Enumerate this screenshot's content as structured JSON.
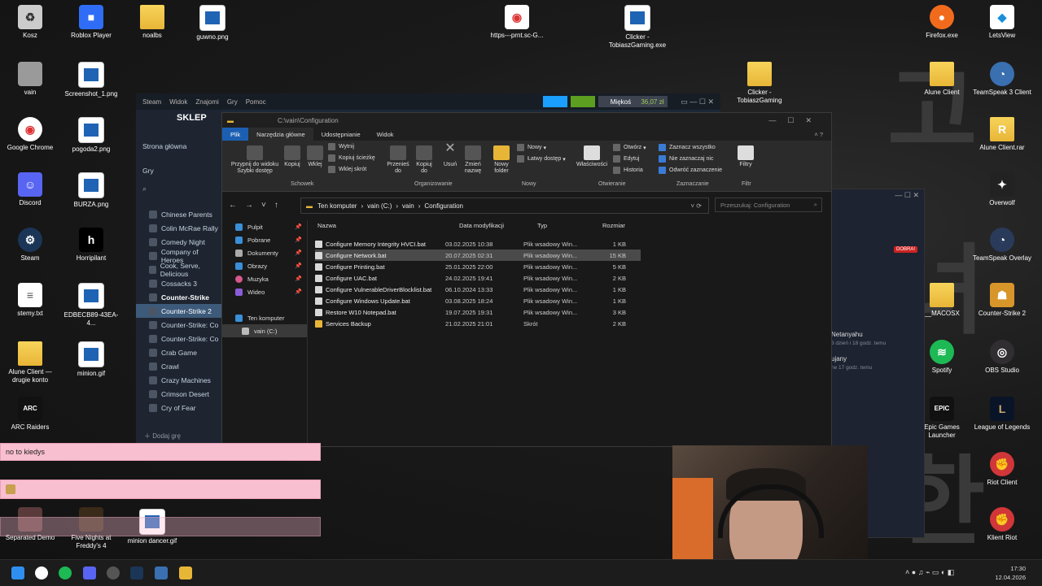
{
  "desktop_icons": [
    {
      "label": "Kosz",
      "icon": "recycle-bin-icon"
    },
    {
      "label": "Roblox Player",
      "icon": "roblox-icon"
    },
    {
      "label": "noalbs",
      "icon": "folder-icon"
    },
    {
      "label": "guwno.png",
      "icon": "image-icon"
    },
    {
      "label": "https---prnt.sc-G...",
      "icon": "chrome-icon"
    },
    {
      "label": "Clicker - TobiaszGaming.exe",
      "icon": "app-icon"
    },
    {
      "label": "Firefox.exe",
      "icon": "firefox-icon"
    },
    {
      "label": "LetsView",
      "icon": "letsview-icon"
    },
    {
      "label": "vain",
      "icon": "folder-icon"
    },
    {
      "label": "Screenshot_1.png",
      "icon": "image-icon"
    },
    {
      "label": "Clicker - TobiaszGaming",
      "icon": "folder-icon"
    },
    {
      "label": "Alune Client",
      "icon": "folder-icon"
    },
    {
      "label": "TeamSpeak 3 Client",
      "icon": "teamspeak-icon"
    },
    {
      "label": "Google Chrome",
      "icon": "chrome-icon"
    },
    {
      "label": "pogoda2.png",
      "icon": "image-icon"
    },
    {
      "label": "Alune Client.rar",
      "icon": "rar-icon"
    },
    {
      "label": "Discord",
      "icon": "discord-icon"
    },
    {
      "label": "BURZA.png",
      "icon": "image-icon"
    },
    {
      "label": "Overwolf",
      "icon": "overwolf-icon"
    },
    {
      "label": "Steam",
      "icon": "steam-icon"
    },
    {
      "label": "Horripilant",
      "icon": "horripilant-icon"
    },
    {
      "label": "TeamSpeak Overlay",
      "icon": "teamspeak-overlay-icon"
    },
    {
      "label": "stemy.txt",
      "icon": "text-file-icon"
    },
    {
      "label": "EDBECB89-43EA-4...",
      "icon": "image-icon"
    },
    {
      "label": "__MACOSX",
      "icon": "folder-icon"
    },
    {
      "label": "Counter-Strike 2",
      "icon": "cs2-icon"
    },
    {
      "label": "Alune Client — drugie konto",
      "icon": "folder-icon"
    },
    {
      "label": "minion.gif",
      "icon": "image-icon"
    },
    {
      "label": "Spotify",
      "icon": "spotify-icon"
    },
    {
      "label": "OBS Studio",
      "icon": "obs-icon"
    },
    {
      "label": "ARC Raiders",
      "icon": "arc-raiders-icon"
    },
    {
      "label": "Epic Games Launcher",
      "icon": "epic-icon"
    },
    {
      "label": "League of Legends",
      "icon": "lol-icon"
    },
    {
      "label": "Riot Client",
      "icon": "riot-icon"
    },
    {
      "label": "Separated Demo",
      "icon": "game-icon"
    },
    {
      "label": "Five Nights at Freddy's 4",
      "icon": "game-icon"
    },
    {
      "label": "minion dancer.gif",
      "icon": "image-icon"
    },
    {
      "label": "Klient Riot",
      "icon": "riot-icon"
    }
  ],
  "steam": {
    "menu": [
      "Steam",
      "Widok",
      "Znajomi",
      "Gry",
      "Pomoc"
    ],
    "store_label": "SKLEP",
    "store_home": "Strona główna",
    "games_label": "Gry",
    "user_name": "Miękoś",
    "wallet": "36,07 zł",
    "add_game": "Dodaj grę",
    "games": [
      "Chinese Parents",
      "Colin McRae Rally",
      "Comedy Night",
      "Company of Heroes",
      "Cook, Serve, Delicious",
      "Cossacks 3",
      "Counter-Strike",
      "Counter-Strike 2",
      "Counter-Strike: Co",
      "Counter-Strike: Co",
      "Crab Game",
      "Crawl",
      "Crazy Machines",
      "Crimson Desert",
      "Cry of Fear"
    ]
  },
  "explorer": {
    "title_path": "C:\\vain\\Configuration",
    "tabs": [
      "Plik",
      "Narzędzia główne",
      "Udostępnianie",
      "Widok"
    ],
    "ribbon": {
      "pin": "Przypnij do widoku Szybki dostęp",
      "copy": "Kopiuj",
      "paste": "Wklej",
      "cut": "Wytnij",
      "copy_path": "Kopiuj ścieżkę",
      "paste_shortcut": "Wklej skrót",
      "move_to": "Przenieś do",
      "copy_to": "Kopiuj do",
      "delete": "Usuń",
      "rename": "Zmień nazwę",
      "new_folder": "Nowy folder",
      "new": "Nowy",
      "easy_access": "Łatwy dostęp",
      "properties": "Właściwości",
      "open": "Otwórz",
      "edit": "Edytuj",
      "history": "Historia",
      "select_all": "Zaznacz wszystko",
      "select_none": "Nie zaznaczaj nic",
      "invert": "Odwróć zaznaczenie",
      "filters": "Filtry",
      "groups": [
        "Schowek",
        "Organizowanie",
        "Nowy",
        "Otwieranie",
        "Zaznaczanie",
        "Filtr"
      ]
    },
    "breadcrumb": [
      "Ten komputer",
      "vain (C:)",
      "vain",
      "Configuration"
    ],
    "search_placeholder": "Przeszukaj: Configuration",
    "nav": [
      "Pulpit",
      "Pobrane",
      "Dokumenty",
      "Obrazy",
      "Muzyka",
      "Wideo",
      "Ten komputer",
      "vain (C:)"
    ],
    "columns": [
      "Nazwa",
      "Data modyfikacji",
      "Typ",
      "Rozmiar"
    ],
    "files": [
      {
        "name": "Configure Memory Integrity HVCI.bat",
        "date": "03.02.2025 10:38",
        "type": "Plik wsadowy Win...",
        "size": "1 KB"
      },
      {
        "name": "Configure Network.bat",
        "date": "20.07.2025 02:31",
        "type": "Plik wsadowy Win...",
        "size": "15 KB"
      },
      {
        "name": "Configure Printing.bat",
        "date": "25.01.2025 22:00",
        "type": "Plik wsadowy Win...",
        "size": "5 KB"
      },
      {
        "name": "Configure UAC.bat",
        "date": "24.02.2025 19:41",
        "type": "Plik wsadowy Win...",
        "size": "2 KB"
      },
      {
        "name": "Configure VulnerableDriverBlocklist.bat",
        "date": "06.10.2024 13:33",
        "type": "Plik wsadowy Win...",
        "size": "1 KB"
      },
      {
        "name": "Configure Windows Update.bat",
        "date": "03.08.2025 18:24",
        "type": "Plik wsadowy Win...",
        "size": "1 KB"
      },
      {
        "name": "Restore W10 Notepad.bat",
        "date": "19.07.2025 19:31",
        "type": "Plik wsadowy Win...",
        "size": "3 KB"
      },
      {
        "name": "Services Backup",
        "date": "21.02.2025 21:01",
        "type": "Skrót",
        "size": "2 KB"
      }
    ]
  },
  "chat": {
    "message1": "no to kiedys"
  },
  "side_chat": {
    "badge": "DOBRA!",
    "name1": "Netanyahu",
    "time1": "3 dzień i 18 godz. temu",
    "name2": "ujany",
    "time2": "ne 17 godz. temu"
  },
  "clock": {
    "time": "17:30",
    "date": "12.04.2026"
  }
}
